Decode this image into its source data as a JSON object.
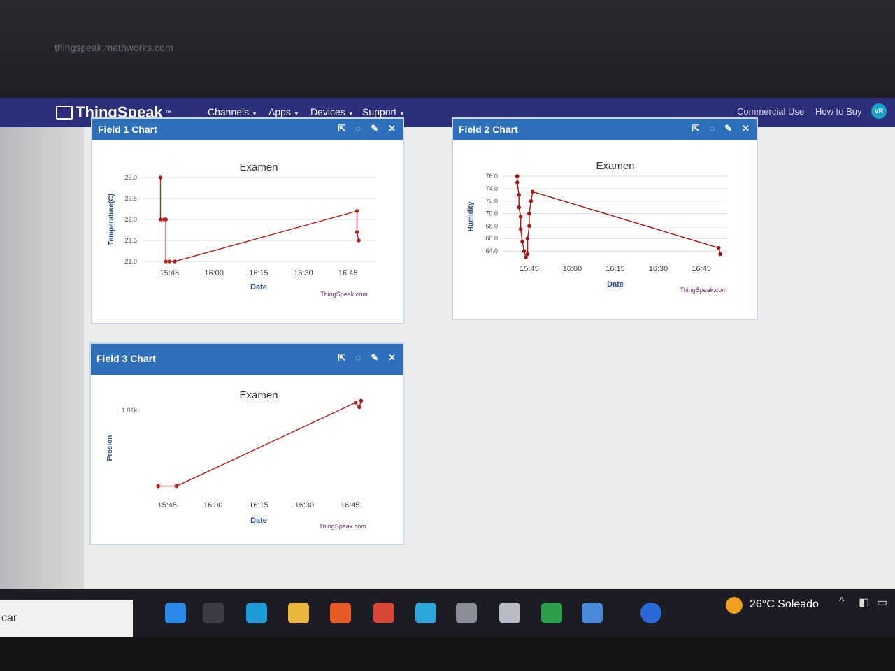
{
  "browser": {
    "url": "thingspeak.mathworks.com"
  },
  "navbar": {
    "logo": "ThingSpeak",
    "menu": [
      {
        "label": "Channels"
      },
      {
        "label": "Apps"
      },
      {
        "label": "Devices"
      },
      {
        "label": "Support"
      }
    ],
    "right": [
      {
        "label": "Commercial Use"
      },
      {
        "label": "How to Buy"
      }
    ],
    "avatar": "VR"
  },
  "cards": [
    {
      "header": "Field 1 Chart",
      "chart_title": "Examen",
      "xlabel": "Date",
      "ylabel": "Temperature(C)",
      "credit": "ThingSpeak.com"
    },
    {
      "header": "Field 2 Chart",
      "chart_title": "Examen",
      "xlabel": "Date",
      "ylabel": "Humidity",
      "credit": "ThingSpeak.com"
    },
    {
      "header": "Field 3 Chart",
      "chart_title": "Examen",
      "xlabel": "Date",
      "ylabel": "Presion",
      "credit": "ThingSpeak.com"
    }
  ],
  "chart_data": [
    {
      "type": "line",
      "title": "Examen",
      "xlabel": "Date",
      "ylabel": "Temperature(C)",
      "x_ticks": [
        "15:45",
        "16:00",
        "16:15",
        "16:30",
        "16:45"
      ],
      "y_ticks": [
        "21.0",
        "21.5",
        "22.0",
        "22.5",
        "23.0"
      ],
      "ylim": [
        21.0,
        23.0
      ],
      "xlim": [
        15.6,
        16.9
      ],
      "series": [
        {
          "color": "#b3221e",
          "points": [
            [
              15.7,
              23.0
            ],
            [
              15.7,
              22.0
            ],
            [
              15.72,
              22.0
            ],
            [
              15.73,
              22.0
            ],
            [
              15.73,
              21.0
            ],
            [
              15.75,
              21.0
            ],
            [
              15.78,
              21.0
            ],
            [
              16.8,
              22.2
            ],
            [
              16.8,
              21.7
            ],
            [
              16.81,
              21.5
            ]
          ]
        }
      ]
    },
    {
      "type": "line",
      "title": "Examen",
      "xlabel": "Date",
      "ylabel": "Humidity",
      "x_ticks": [
        "15:45",
        "16:00",
        "16:15",
        "16:30",
        "16:45"
      ],
      "y_ticks": [
        "64.0",
        "66.0",
        "68.0",
        "70.0",
        "72.0",
        "74.0",
        "76.0"
      ],
      "ylim": [
        63.0,
        76.0
      ],
      "xlim": [
        15.6,
        16.9
      ],
      "series": [
        {
          "color": "#9e1a16",
          "points": [
            [
              15.68,
              76.0
            ],
            [
              15.68,
              75.0
            ],
            [
              15.69,
              73.0
            ],
            [
              15.69,
              71.0
            ],
            [
              15.7,
              69.5
            ],
            [
              15.7,
              67.5
            ],
            [
              15.71,
              65.5
            ],
            [
              15.72,
              64.0
            ],
            [
              15.73,
              63.0
            ],
            [
              15.74,
              63.5
            ],
            [
              15.74,
              66.0
            ],
            [
              15.75,
              68.0
            ],
            [
              15.75,
              70.0
            ],
            [
              15.76,
              72.0
            ],
            [
              15.77,
              73.5
            ],
            [
              16.85,
              64.5
            ],
            [
              16.86,
              63.5
            ]
          ]
        }
      ]
    },
    {
      "type": "line",
      "title": "Examen",
      "xlabel": "Date",
      "ylabel": "Presion",
      "x_ticks": [
        "15:45",
        "16:00",
        "16:15",
        "16:30",
        "16:45"
      ],
      "y_ticks": [
        "1.01k"
      ],
      "xlim": [
        15.6,
        16.9
      ],
      "ylim": [
        0,
        1
      ],
      "series": [
        {
          "color": "#b3221e",
          "points": [
            [
              15.7,
              0.08
            ],
            [
              15.8,
              0.08
            ],
            [
              16.78,
              1.0
            ],
            [
              16.8,
              0.95
            ],
            [
              16.81,
              1.02
            ]
          ]
        }
      ]
    }
  ],
  "taskbar": {
    "search": "car",
    "weather": "26°C  Soleado"
  }
}
